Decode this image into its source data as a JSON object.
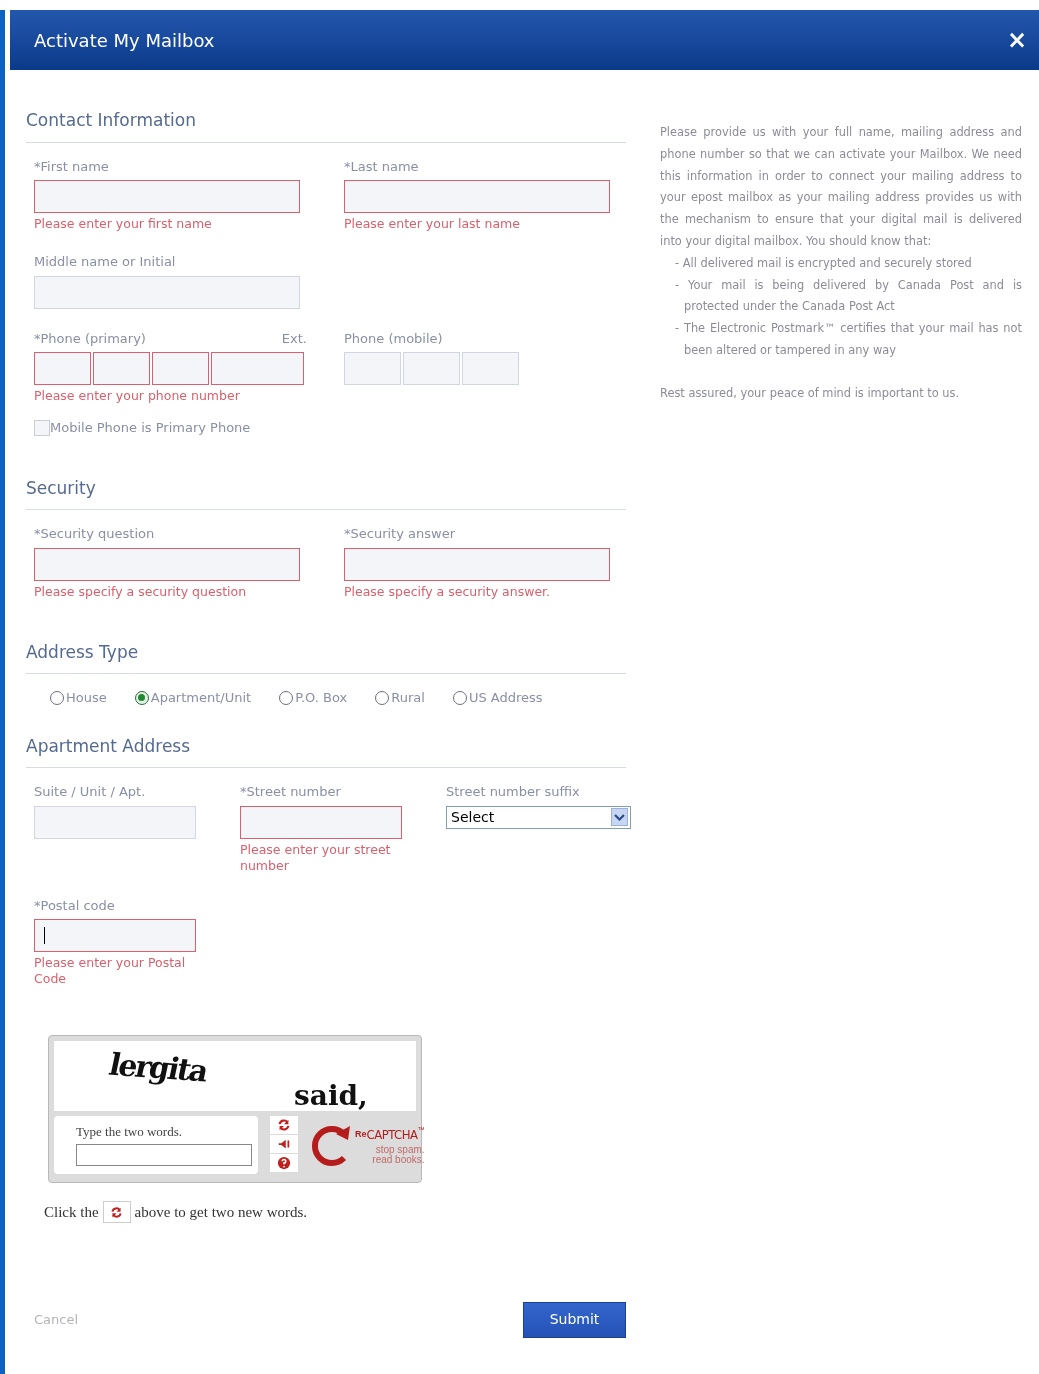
{
  "dialog": {
    "title": "Activate My Mailbox",
    "close": "×"
  },
  "contact": {
    "heading": "Contact Information",
    "first_name": {
      "label": "*First name",
      "invalid": true,
      "error": "Please enter your first name"
    },
    "last_name": {
      "label": "*Last name",
      "invalid": true,
      "error": "Please enter your last name"
    },
    "middle_name": {
      "label": "Middle name or Initial",
      "invalid": false
    },
    "phone_primary": {
      "label": "*Phone (primary)",
      "ext_label": "Ext.",
      "invalid": true,
      "error": "Please enter your phone number"
    },
    "phone_mobile": {
      "label": "Phone (mobile)",
      "invalid": false
    },
    "mobile_primary": {
      "label": "Mobile Phone is Primary Phone",
      "checked": false
    }
  },
  "security": {
    "heading": "Security",
    "question": {
      "label": "*Security question",
      "invalid": true,
      "error": "Please specify a security question"
    },
    "answer": {
      "label": "*Security answer",
      "invalid": true,
      "error": "Please specify a security answer."
    }
  },
  "address_type": {
    "heading": "Address Type",
    "options": [
      {
        "label": "House",
        "selected": false
      },
      {
        "label": "Apartment/Unit",
        "selected": true
      },
      {
        "label": "P.O. Box",
        "selected": false
      },
      {
        "label": "Rural",
        "selected": false
      },
      {
        "label": "US Address",
        "selected": false
      }
    ]
  },
  "apartment": {
    "heading": "Apartment Address",
    "suite": {
      "label": "Suite / Unit / Apt.",
      "invalid": false
    },
    "street_number": {
      "label": "*Street number",
      "invalid": true,
      "error": "Please enter your street number"
    },
    "suffix": {
      "label": "Street number suffix",
      "value": "Select"
    },
    "postal_code": {
      "label": "*Postal code",
      "invalid": true,
      "focused": true,
      "error": "Please enter your Postal Code"
    }
  },
  "captcha": {
    "words": [
      "lergita",
      "said,"
    ],
    "prompt": "Type the two words.",
    "logo_prefix": "Re",
    "logo": "CAPTCHA",
    "logo_mark": "™",
    "tagline": [
      "stop spam.",
      "read books."
    ]
  },
  "captcha_hint": {
    "before": "Click the",
    "after": "above to get two new words."
  },
  "info": {
    "intro": "Please provide us with your full name, mailing address and phone number so that we can activate your Mailbox. We need this information in order to connect your mailing address to your epost mailbox as your mailing address provides us with the mechanism to ensure that your digital mail is delivered into your digital mailbox. You should know that:",
    "bullets": [
      "- All delivered mail is encrypted and securely stored",
      "- Your mail is being delivered by Canada Post and is protected under the Canada Post Act",
      "- The Electronic Postmark™ certifies that your mail has not been altered or tampered in any way"
    ],
    "closing": "Rest assured, your peace of mind is important to us."
  },
  "footer": {
    "cancel": "Cancel",
    "submit": "Submit"
  }
}
